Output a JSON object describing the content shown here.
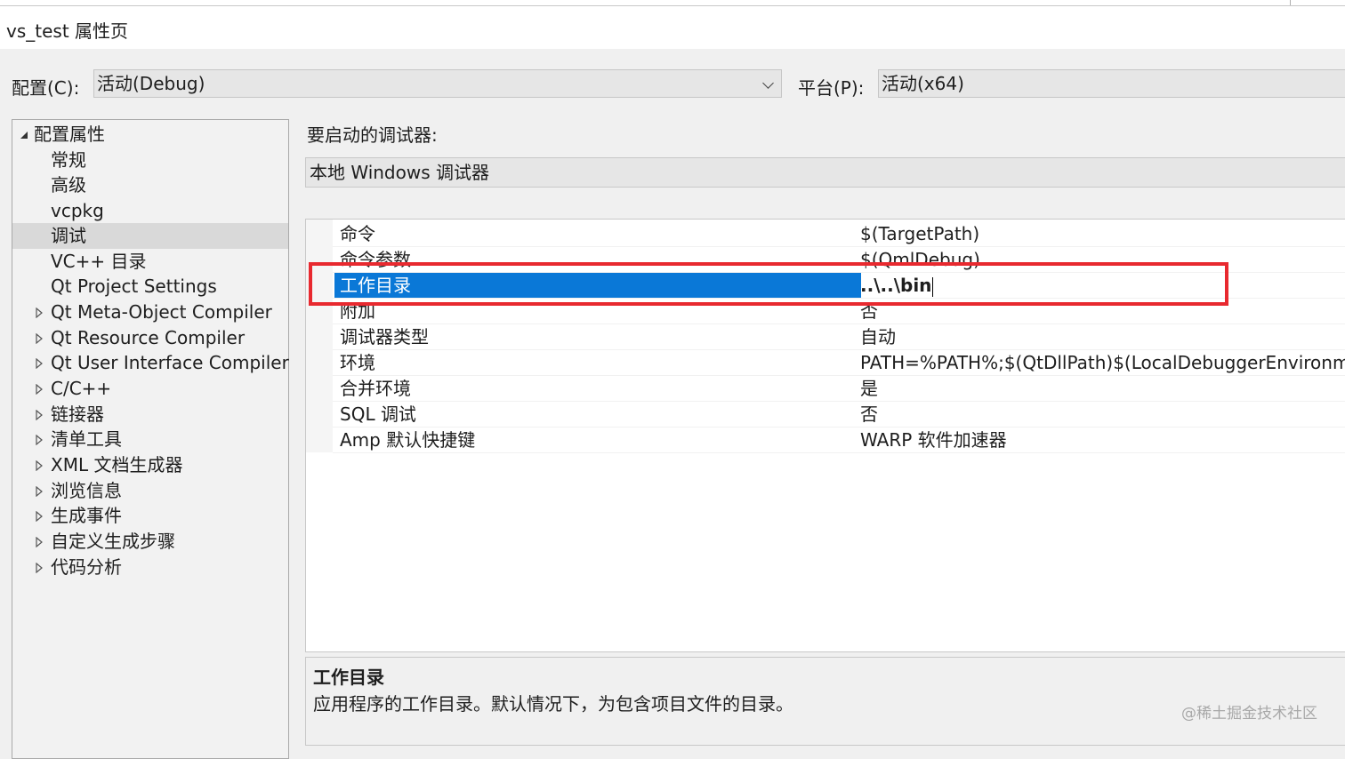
{
  "window": {
    "title": "vs_test 属性页"
  },
  "header": {
    "config_label": "配置(C):",
    "config_value": "活动(Debug)",
    "platform_label": "平台(P):",
    "platform_value": "活动(x64)"
  },
  "tree": {
    "root": "配置属性",
    "items": [
      "常规",
      "高级",
      "vcpkg",
      "调试",
      "VC++ 目录",
      "Qt Project Settings",
      "Qt Meta-Object Compiler",
      "Qt Resource Compiler",
      "Qt User Interface Compiler",
      "C/C++",
      "链接器",
      "清单工具",
      "XML 文档生成器",
      "浏览信息",
      "生成事件",
      "自定义生成步骤",
      "代码分析"
    ],
    "selected": "调试"
  },
  "debugger": {
    "label": "要启动的调试器:",
    "value": "本地 Windows 调试器"
  },
  "properties": [
    {
      "name": "命令",
      "value": "$(TargetPath)"
    },
    {
      "name": "命令参数",
      "value": "$(QmlDebug)"
    },
    {
      "name": "工作目录",
      "value": "..\\..\\bin"
    },
    {
      "name": "附加",
      "value": "否"
    },
    {
      "name": "调试器类型",
      "value": "自动"
    },
    {
      "name": "环境",
      "value": "PATH=%PATH%;$(QtDllPath)$(LocalDebuggerEnvironment)"
    },
    {
      "name": "合并环境",
      "value": "是"
    },
    {
      "name": "SQL 调试",
      "value": "否"
    },
    {
      "name": "Amp 默认快捷键",
      "value": "WARP 软件加速器"
    }
  ],
  "description": {
    "title": "工作目录",
    "text": "应用程序的工作目录。默认情况下，为包含项目文件的目录。"
  },
  "watermark": "@稀土掘金技术社区",
  "colors": {
    "selection": "#0a78d7",
    "annotation_box": "#e8292f"
  }
}
